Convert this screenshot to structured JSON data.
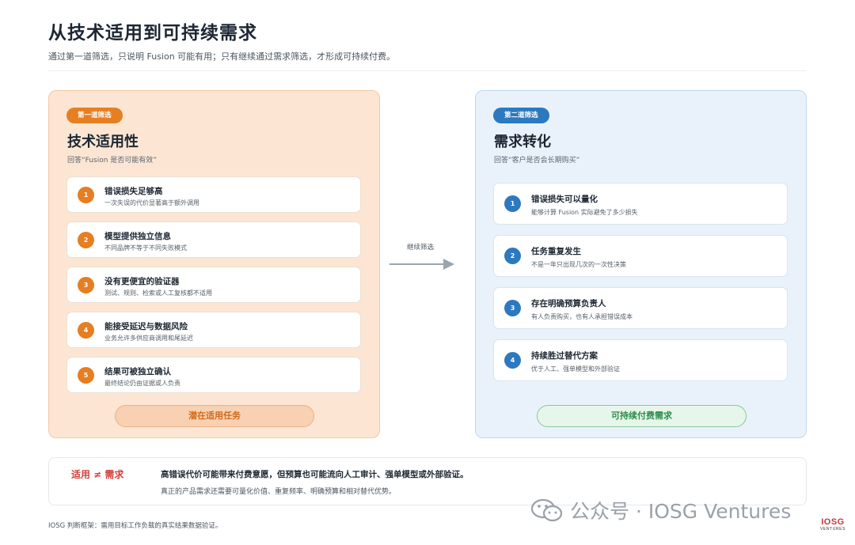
{
  "header": {
    "title": "从技术适用到可持续需求",
    "subtitle": "通过第一道筛选，只说明 Fusion 可能有用；只有继续通过需求筛选，才形成可持续付费。"
  },
  "left_panel": {
    "badge": "第一道筛选",
    "title": "技术适用性",
    "subtitle": "回答“Fusion 是否可能有效”",
    "items": [
      {
        "num": "1",
        "title": "错误损失足够高",
        "desc": "一次失误的代价显著高于额外调用"
      },
      {
        "num": "2",
        "title": "模型提供独立信息",
        "desc": "不同品牌不等于不同失败模式"
      },
      {
        "num": "3",
        "title": "没有更便宜的验证器",
        "desc": "测试、规则、检索或人工复核都不适用"
      },
      {
        "num": "4",
        "title": "能接受延迟与数据风险",
        "desc": "业务允许多供应商调用和尾延迟"
      },
      {
        "num": "5",
        "title": "结果可被独立确认",
        "desc": "最终结论仍由证据或人负责"
      }
    ],
    "footer": "潜在适用任务"
  },
  "connector": {
    "label": "继续筛选"
  },
  "right_panel": {
    "badge": "第二道筛选",
    "title": "需求转化",
    "subtitle": "回答“客户是否会长期购买”",
    "items": [
      {
        "num": "1",
        "title": "错误损失可以量化",
        "desc": "能够计算 Fusion 实际避免了多少损失"
      },
      {
        "num": "2",
        "title": "任务重复发生",
        "desc": "不是一年只出现几次的一次性决策"
      },
      {
        "num": "3",
        "title": "存在明确预算负责人",
        "desc": "有人负责购买，也有人承担错误成本"
      },
      {
        "num": "4",
        "title": "持续胜过替代方案",
        "desc": "优于人工、强单模型和外部验证"
      }
    ],
    "footer": "可持续付费需求"
  },
  "bottom": {
    "label": "适用 ≠ 需求",
    "main": "高错误代价可能带来付费意愿，但预算也可能流向人工审计、强单模型或外部验证。",
    "sub": "真正的产品需求还需要可量化价值、重复频率、明确预算和相对替代优势。"
  },
  "note": "IOSG 判断框架：需用目标工作负载的真实结果数据验证。",
  "watermark": {
    "text": "公众号 · IOSG Ventures",
    "icon": "wechat-icon"
  },
  "logo": {
    "main": "IOSG",
    "sub": "VENTURES"
  },
  "colors": {
    "orange": "#e67e22",
    "blue": "#2c79bf",
    "green": "#2e8c4c",
    "red": "#d2413c"
  }
}
